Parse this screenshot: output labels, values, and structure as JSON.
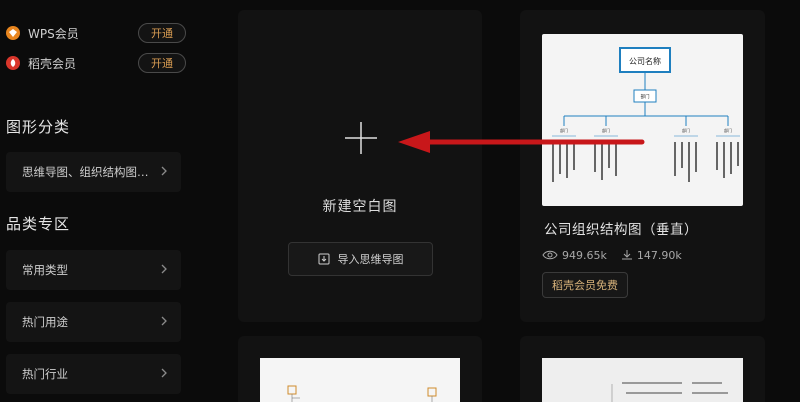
{
  "sidebar": {
    "members": [
      {
        "label": "WPS会员",
        "action": "开通",
        "icon": "wps-member-icon",
        "color": "#e8851e"
      },
      {
        "label": "稻壳会员",
        "action": "开通",
        "icon": "docer-member-icon",
        "color": "#d9362b"
      }
    ],
    "section_shape": "图形分类",
    "shape_item": "思维导图、组织结构图…",
    "section_category": "品类专区",
    "category_items": [
      "常用类型",
      "热门用途",
      "热门行业"
    ]
  },
  "new_card": {
    "label": "新建空白图",
    "import_label": "导入思维导图"
  },
  "template": {
    "title": "公司组织结构图（垂直）",
    "views": "949.65k",
    "downloads": "147.90k",
    "badge": "稻壳会员免费",
    "thumb": {
      "root": "公司名称",
      "mid": "部门",
      "level2": [
        "部门",
        "部门",
        "部门",
        "部门"
      ]
    }
  },
  "colors": {
    "accent_orange": "#d79b52",
    "arrow_red": "#c8171a",
    "thumb_blue": "#1f7fbf"
  }
}
